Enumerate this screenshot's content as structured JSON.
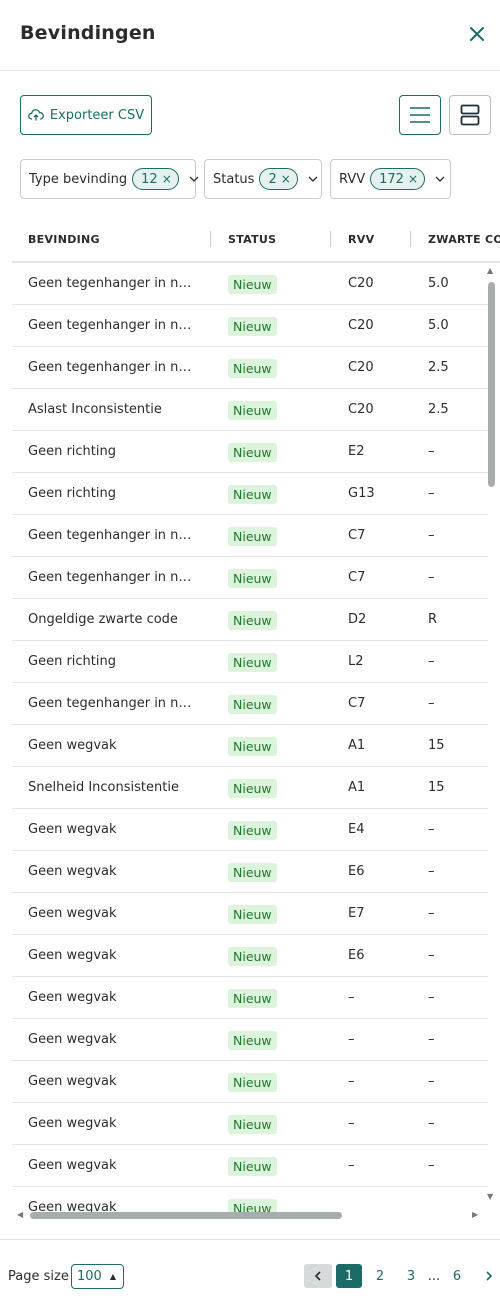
{
  "header": {
    "title": "Bevindingen"
  },
  "toolbar": {
    "export_label": "Exporteer CSV"
  },
  "filters": [
    {
      "label": "Type bevinding",
      "count": "12"
    },
    {
      "label": "Status",
      "count": "2"
    },
    {
      "label": "RVV",
      "count": "172"
    }
  ],
  "table": {
    "columns": [
      "BEVINDING",
      "STATUS",
      "RVV",
      "ZWARTE CODE"
    ],
    "rows": [
      {
        "bevinding": "Geen tegenhanger in netwerk",
        "status": "Nieuw",
        "rvv": "C20",
        "code": "5.0"
      },
      {
        "bevinding": "Geen tegenhanger in netwerk",
        "status": "Nieuw",
        "rvv": "C20",
        "code": "5.0"
      },
      {
        "bevinding": "Geen tegenhanger in netwerk",
        "status": "Nieuw",
        "rvv": "C20",
        "code": "2.5"
      },
      {
        "bevinding": "Aslast Inconsistentie",
        "status": "Nieuw",
        "rvv": "C20",
        "code": "2.5"
      },
      {
        "bevinding": "Geen richting",
        "status": "Nieuw",
        "rvv": "E2",
        "code": "–"
      },
      {
        "bevinding": "Geen richting",
        "status": "Nieuw",
        "rvv": "G13",
        "code": "–"
      },
      {
        "bevinding": "Geen tegenhanger in netwerk",
        "status": "Nieuw",
        "rvv": "C7",
        "code": "–"
      },
      {
        "bevinding": "Geen tegenhanger in netwerk",
        "status": "Nieuw",
        "rvv": "C7",
        "code": "–"
      },
      {
        "bevinding": "Ongeldige zwarte code",
        "status": "Nieuw",
        "rvv": "D2",
        "code": "R"
      },
      {
        "bevinding": "Geen richting",
        "status": "Nieuw",
        "rvv": "L2",
        "code": "–"
      },
      {
        "bevinding": "Geen tegenhanger in netwerk",
        "status": "Nieuw",
        "rvv": "C7",
        "code": "–"
      },
      {
        "bevinding": "Geen wegvak",
        "status": "Nieuw",
        "rvv": "A1",
        "code": "15"
      },
      {
        "bevinding": "Snelheid Inconsistentie",
        "status": "Nieuw",
        "rvv": "A1",
        "code": "15"
      },
      {
        "bevinding": "Geen wegvak",
        "status": "Nieuw",
        "rvv": "E4",
        "code": "–"
      },
      {
        "bevinding": "Geen wegvak",
        "status": "Nieuw",
        "rvv": "E6",
        "code": "–"
      },
      {
        "bevinding": "Geen wegvak",
        "status": "Nieuw",
        "rvv": "E7",
        "code": "–"
      },
      {
        "bevinding": "Geen wegvak",
        "status": "Nieuw",
        "rvv": "E6",
        "code": "–"
      },
      {
        "bevinding": "Geen wegvak",
        "status": "Nieuw",
        "rvv": "–",
        "code": "–"
      },
      {
        "bevinding": "Geen wegvak",
        "status": "Nieuw",
        "rvv": "–",
        "code": "–"
      },
      {
        "bevinding": "Geen wegvak",
        "status": "Nieuw",
        "rvv": "–",
        "code": "–"
      },
      {
        "bevinding": "Geen wegvak",
        "status": "Nieuw",
        "rvv": "–",
        "code": "–"
      },
      {
        "bevinding": "Geen wegvak",
        "status": "Nieuw",
        "rvv": "–",
        "code": "–"
      },
      {
        "bevinding": "Geen wegvak",
        "status": "Nieuw",
        "rvv": "",
        "code": ""
      }
    ]
  },
  "footer": {
    "page_size_label": "Page size",
    "page_size_value": "100",
    "pages": [
      "1",
      "2",
      "3",
      "...",
      "6"
    ],
    "current_page": "1"
  },
  "colors": {
    "accent": "#1c6b66",
    "badge_bg": "#dcf3dc",
    "badge_text": "#1e7a2e",
    "border": "#e3e6e6"
  },
  "icons": [
    "close-icon",
    "cloud-upload-icon",
    "list-view-icon",
    "card-view-icon",
    "chevron-down-icon",
    "chevron-left-icon",
    "chevron-right-icon"
  ]
}
